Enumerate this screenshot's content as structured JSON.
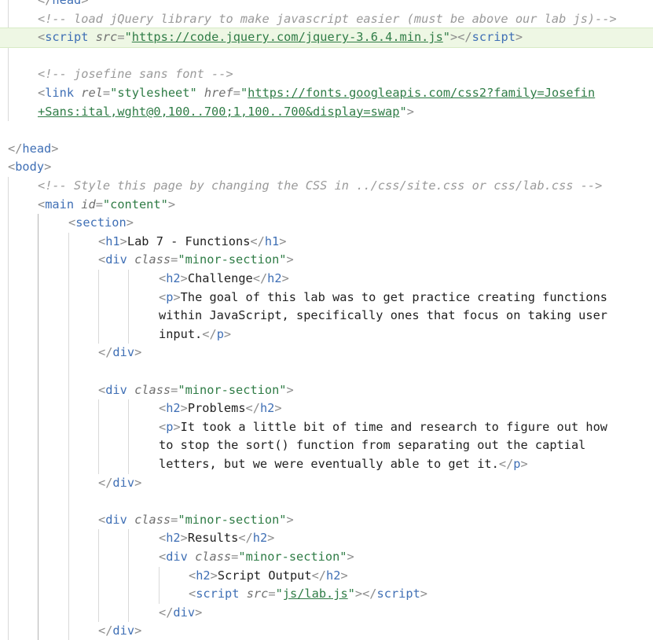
{
  "editor": {
    "language": "html",
    "highlight_color": "#eef7e4",
    "colors": {
      "tag": "#3f6fb5",
      "attribute": "#6f6f6f",
      "string": "#2f7c46",
      "comment": "#9a9a9a",
      "text": "#1f1f1f",
      "bracket": "#8c8c8c"
    },
    "lines": [
      {
        "indent": 1,
        "tokens": [
          {
            "t": "br",
            "v": "</"
          },
          {
            "t": "tag",
            "v": "head"
          },
          {
            "t": "br",
            "v": ">"
          }
        ]
      },
      {
        "indent": 1,
        "tokens": [
          {
            "t": "cm",
            "v": "<!-- load jQuery library to make javascript easier (must be above our lab js)-->"
          }
        ]
      },
      {
        "indent": 1,
        "highlight": true,
        "tokens": [
          {
            "t": "br",
            "v": "<"
          },
          {
            "t": "tag",
            "v": "script"
          },
          {
            "t": "sp",
            "v": " "
          },
          {
            "t": "attr",
            "v": "src"
          },
          {
            "t": "eq",
            "v": "="
          },
          {
            "t": "str",
            "v": "\""
          },
          {
            "t": "url",
            "v": "https://code.jquery.com/jquery-3.6.4.min.js"
          },
          {
            "t": "str",
            "v": "\""
          },
          {
            "t": "br",
            "v": "></"
          },
          {
            "t": "tag",
            "v": "script"
          },
          {
            "t": "br",
            "v": ">"
          }
        ]
      },
      {
        "indent": 1,
        "tokens": []
      },
      {
        "indent": 1,
        "tokens": [
          {
            "t": "cm",
            "v": "<!-- josefine sans font -->"
          }
        ]
      },
      {
        "indent": 1,
        "tokens": [
          {
            "t": "br",
            "v": "<"
          },
          {
            "t": "tag",
            "v": "link"
          },
          {
            "t": "sp",
            "v": " "
          },
          {
            "t": "attr",
            "v": "rel"
          },
          {
            "t": "eq",
            "v": "="
          },
          {
            "t": "str",
            "v": "\"stylesheet\""
          },
          {
            "t": "sp",
            "v": " "
          },
          {
            "t": "attr",
            "v": "href"
          },
          {
            "t": "eq",
            "v": "="
          },
          {
            "t": "str",
            "v": "\""
          },
          {
            "t": "url",
            "v": "https://fonts.googleapis.com/css2?family=Josefin"
          }
        ]
      },
      {
        "indent": 1,
        "tokens": [
          {
            "t": "url",
            "v": "+Sans:ital,wght@0,100..700;1,100..700&display=swap"
          },
          {
            "t": "str",
            "v": "\""
          },
          {
            "t": "br",
            "v": ">"
          }
        ]
      },
      {
        "indent": 0,
        "tokens": []
      },
      {
        "indent": 0,
        "tokens": [
          {
            "t": "br",
            "v": "</"
          },
          {
            "t": "tag",
            "v": "head"
          },
          {
            "t": "br",
            "v": ">"
          }
        ]
      },
      {
        "indent": 0,
        "tokens": [
          {
            "t": "br",
            "v": "<"
          },
          {
            "t": "tag",
            "v": "body"
          },
          {
            "t": "br",
            "v": ">"
          }
        ]
      },
      {
        "indent": 1,
        "tokens": [
          {
            "t": "cm",
            "v": "<!-- Style this page by changing the CSS in ../css/site.css or css/lab.css -->"
          }
        ]
      },
      {
        "indent": 1,
        "tokens": [
          {
            "t": "br",
            "v": "<"
          },
          {
            "t": "tag",
            "v": "main"
          },
          {
            "t": "sp",
            "v": " "
          },
          {
            "t": "attr",
            "v": "id"
          },
          {
            "t": "eq",
            "v": "="
          },
          {
            "t": "str",
            "v": "\"content\""
          },
          {
            "t": "br",
            "v": ">"
          }
        ]
      },
      {
        "indent": 2,
        "tokens": [
          {
            "t": "br",
            "v": "<"
          },
          {
            "t": "tag",
            "v": "section"
          },
          {
            "t": "br",
            "v": ">"
          }
        ]
      },
      {
        "indent": 3,
        "tokens": [
          {
            "t": "br",
            "v": "<"
          },
          {
            "t": "tag",
            "v": "h1"
          },
          {
            "t": "br",
            "v": ">"
          },
          {
            "t": "txt",
            "v": "Lab 7 - Functions"
          },
          {
            "t": "br",
            "v": "</"
          },
          {
            "t": "tag",
            "v": "h1"
          },
          {
            "t": "br",
            "v": ">"
          }
        ]
      },
      {
        "indent": 3,
        "tokens": [
          {
            "t": "br",
            "v": "<"
          },
          {
            "t": "tag",
            "v": "div"
          },
          {
            "t": "sp",
            "v": " "
          },
          {
            "t": "attr",
            "v": "class"
          },
          {
            "t": "eq",
            "v": "="
          },
          {
            "t": "str",
            "v": "\"minor-section\""
          },
          {
            "t": "br",
            "v": ">"
          }
        ]
      },
      {
        "indent": 5,
        "tokens": [
          {
            "t": "br",
            "v": "<"
          },
          {
            "t": "tag",
            "v": "h2"
          },
          {
            "t": "br",
            "v": ">"
          },
          {
            "t": "txt",
            "v": "Challenge"
          },
          {
            "t": "br",
            "v": "</"
          },
          {
            "t": "tag",
            "v": "h2"
          },
          {
            "t": "br",
            "v": ">"
          }
        ]
      },
      {
        "indent": 5,
        "tokens": [
          {
            "t": "br",
            "v": "<"
          },
          {
            "t": "tag",
            "v": "p"
          },
          {
            "t": "br",
            "v": ">"
          },
          {
            "t": "txt",
            "v": "The goal of this lab was to get practice creating functions"
          }
        ]
      },
      {
        "indent": 5,
        "tokens": [
          {
            "t": "txt",
            "v": "within JavaScript, specifically ones that focus on taking user"
          }
        ]
      },
      {
        "indent": 5,
        "tokens": [
          {
            "t": "txt",
            "v": "input."
          },
          {
            "t": "br",
            "v": "</"
          },
          {
            "t": "tag",
            "v": "p"
          },
          {
            "t": "br",
            "v": ">"
          }
        ]
      },
      {
        "indent": 3,
        "tokens": [
          {
            "t": "br",
            "v": "</"
          },
          {
            "t": "tag",
            "v": "div"
          },
          {
            "t": "br",
            "v": ">"
          }
        ]
      },
      {
        "indent": 3,
        "tokens": []
      },
      {
        "indent": 3,
        "tokens": [
          {
            "t": "br",
            "v": "<"
          },
          {
            "t": "tag",
            "v": "div"
          },
          {
            "t": "sp",
            "v": " "
          },
          {
            "t": "attr",
            "v": "class"
          },
          {
            "t": "eq",
            "v": "="
          },
          {
            "t": "str",
            "v": "\"minor-section\""
          },
          {
            "t": "br",
            "v": ">"
          }
        ]
      },
      {
        "indent": 5,
        "tokens": [
          {
            "t": "br",
            "v": "<"
          },
          {
            "t": "tag",
            "v": "h2"
          },
          {
            "t": "br",
            "v": ">"
          },
          {
            "t": "txt",
            "v": "Problems"
          },
          {
            "t": "br",
            "v": "</"
          },
          {
            "t": "tag",
            "v": "h2"
          },
          {
            "t": "br",
            "v": ">"
          }
        ]
      },
      {
        "indent": 5,
        "tokens": [
          {
            "t": "br",
            "v": "<"
          },
          {
            "t": "tag",
            "v": "p"
          },
          {
            "t": "br",
            "v": ">"
          },
          {
            "t": "txt",
            "v": "It took a little bit of time and research to figure out how"
          }
        ]
      },
      {
        "indent": 5,
        "tokens": [
          {
            "t": "txt",
            "v": "to stop the sort() function from separating out the captial"
          }
        ]
      },
      {
        "indent": 5,
        "tokens": [
          {
            "t": "txt",
            "v": "letters, but we were eventually able to get it."
          },
          {
            "t": "br",
            "v": "</"
          },
          {
            "t": "tag",
            "v": "p"
          },
          {
            "t": "br",
            "v": ">"
          }
        ]
      },
      {
        "indent": 3,
        "tokens": [
          {
            "t": "br",
            "v": "</"
          },
          {
            "t": "tag",
            "v": "div"
          },
          {
            "t": "br",
            "v": ">"
          }
        ]
      },
      {
        "indent": 3,
        "tokens": []
      },
      {
        "indent": 3,
        "tokens": [
          {
            "t": "br",
            "v": "<"
          },
          {
            "t": "tag",
            "v": "div"
          },
          {
            "t": "sp",
            "v": " "
          },
          {
            "t": "attr",
            "v": "class"
          },
          {
            "t": "eq",
            "v": "="
          },
          {
            "t": "str",
            "v": "\"minor-section\""
          },
          {
            "t": "br",
            "v": ">"
          }
        ]
      },
      {
        "indent": 5,
        "tokens": [
          {
            "t": "br",
            "v": "<"
          },
          {
            "t": "tag",
            "v": "h2"
          },
          {
            "t": "br",
            "v": ">"
          },
          {
            "t": "txt",
            "v": "Results"
          },
          {
            "t": "br",
            "v": "</"
          },
          {
            "t": "tag",
            "v": "h2"
          },
          {
            "t": "br",
            "v": ">"
          }
        ]
      },
      {
        "indent": 5,
        "tokens": [
          {
            "t": "br",
            "v": "<"
          },
          {
            "t": "tag",
            "v": "div"
          },
          {
            "t": "sp",
            "v": " "
          },
          {
            "t": "attr",
            "v": "class"
          },
          {
            "t": "eq",
            "v": "="
          },
          {
            "t": "str",
            "v": "\"minor-section\""
          },
          {
            "t": "br",
            "v": ">"
          }
        ]
      },
      {
        "indent": 6,
        "tokens": [
          {
            "t": "br",
            "v": "<"
          },
          {
            "t": "tag",
            "v": "h2"
          },
          {
            "t": "br",
            "v": ">"
          },
          {
            "t": "txt",
            "v": "Script Output"
          },
          {
            "t": "br",
            "v": "</"
          },
          {
            "t": "tag",
            "v": "h2"
          },
          {
            "t": "br",
            "v": ">"
          }
        ]
      },
      {
        "indent": 6,
        "tokens": [
          {
            "t": "br",
            "v": "<"
          },
          {
            "t": "tag",
            "v": "script"
          },
          {
            "t": "sp",
            "v": " "
          },
          {
            "t": "attr",
            "v": "src"
          },
          {
            "t": "eq",
            "v": "="
          },
          {
            "t": "str",
            "v": "\""
          },
          {
            "t": "url",
            "v": "js/lab.js"
          },
          {
            "t": "str",
            "v": "\""
          },
          {
            "t": "br",
            "v": "></"
          },
          {
            "t": "tag",
            "v": "script"
          },
          {
            "t": "br",
            "v": ">"
          }
        ]
      },
      {
        "indent": 5,
        "tokens": [
          {
            "t": "br",
            "v": "</"
          },
          {
            "t": "tag",
            "v": "div"
          },
          {
            "t": "br",
            "v": ">"
          }
        ]
      },
      {
        "indent": 3,
        "tokens": [
          {
            "t": "br",
            "v": "</"
          },
          {
            "t": "tag",
            "v": "div"
          },
          {
            "t": "br",
            "v": ">"
          }
        ]
      }
    ]
  }
}
